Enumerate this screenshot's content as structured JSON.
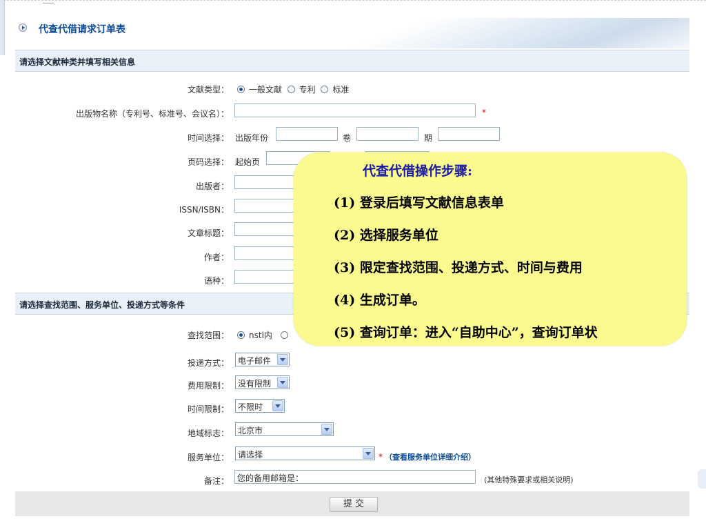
{
  "header": {
    "title": "代查代借请求订单表"
  },
  "section1": {
    "title": "请选择文献种类并填写相关信息"
  },
  "doc_type": {
    "label": "文献类型：",
    "options": [
      "一般文献",
      "专利",
      "标准"
    ],
    "selected": "一般文献"
  },
  "publication_name": {
    "label": "出版物名称（专利号、标准号、会议名）：",
    "value": "",
    "required_mark": "*"
  },
  "time_select": {
    "label": "时间选择：",
    "year_label": "出版年份",
    "volume_label": "卷",
    "issue_label": "期"
  },
  "page_select": {
    "label": "页码选择：",
    "start_label": "起始页"
  },
  "publisher": {
    "label": "出版者："
  },
  "issn": {
    "label": "ISSN/ISBN："
  },
  "article_title": {
    "label": "文章标题："
  },
  "author": {
    "label": "作者："
  },
  "language": {
    "label": "语种："
  },
  "section2": {
    "title": "请选择查找范围、服务单位、投递方式等条件"
  },
  "search_scope": {
    "label": "查找范围：",
    "option": "nstl内"
  },
  "delivery": {
    "label": "投递方式：",
    "value": "电子邮件"
  },
  "fee_limit": {
    "label": "费用限制：",
    "value": "没有限制"
  },
  "time_limit": {
    "label": "时间限制：",
    "value": "不限时"
  },
  "region": {
    "label": "地域标志：",
    "value": "北京市"
  },
  "service_unit": {
    "label": "服务单位：",
    "value": "请选择",
    "required_mark": "*",
    "link": "（查看服务单位详细介绍）"
  },
  "remark": {
    "label": "备注：",
    "value": "您的备用邮箱是：",
    "hint": "(其他特殊要求或相关说明)"
  },
  "submit": {
    "label": "提 交"
  },
  "callout": {
    "title": "代查代借操作步骤:",
    "steps": [
      "(1) 登录后填写文献信息表单",
      "(2) 选择服务单位",
      "(3) 限定查找范围、投递方式、时间与费用",
      "(4)  生成订单。",
      "(5) 查询订单：进入“自助中心”，查询订单状"
    ]
  },
  "colors": {
    "header_title": "#0b4a96",
    "section_bg": "#e9f0f8",
    "callout_bg": "#fbfa8f",
    "callout_title": "#1a1aa6",
    "required": "#dd0000"
  }
}
